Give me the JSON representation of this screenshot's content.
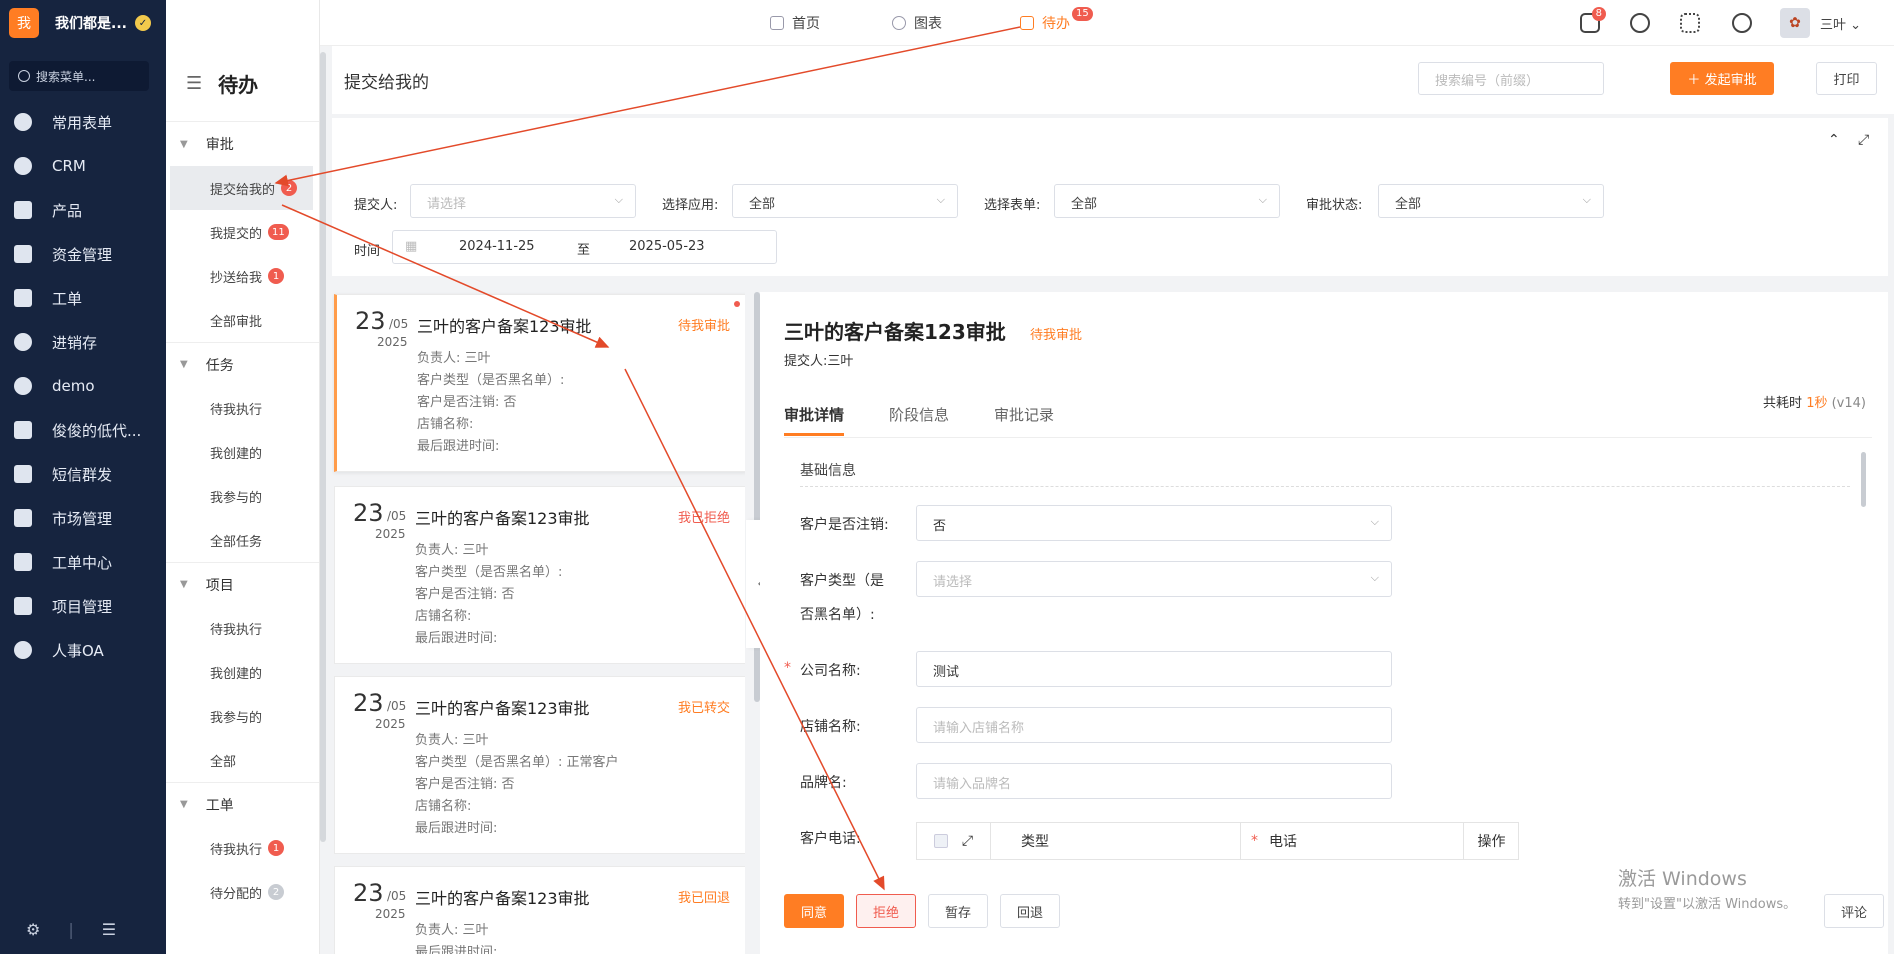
{
  "brand": {
    "logo_text": "我",
    "name": "我们都是..."
  },
  "sidebar": {
    "search_placeholder": "搜索菜单...",
    "items": [
      {
        "label": "常用表单",
        "icon": "star-icon"
      },
      {
        "label": "CRM",
        "icon": "pie-icon"
      },
      {
        "label": "产品",
        "icon": "boxes-icon"
      },
      {
        "label": "资金管理",
        "icon": "wallet-icon"
      },
      {
        "label": "工单",
        "icon": "clipboard-icon"
      },
      {
        "label": "进销存",
        "icon": "cycle-icon"
      },
      {
        "label": "demo",
        "icon": "gear-icon"
      },
      {
        "label": "俊俊的低代...",
        "icon": "doc-icon"
      },
      {
        "label": "短信群发",
        "icon": "mail-icon"
      },
      {
        "label": "市场管理",
        "icon": "clipboard-icon"
      },
      {
        "label": "工单中心",
        "icon": "clipboard-icon"
      },
      {
        "label": "项目管理",
        "icon": "layers-icon"
      },
      {
        "label": "人事OA",
        "icon": "globe-icon"
      }
    ]
  },
  "submenu": {
    "title": "待办",
    "groups": [
      {
        "label": "审批",
        "items": [
          {
            "label": "提交给我的",
            "badge": "2"
          },
          {
            "label": "我提交的",
            "badge": "11"
          },
          {
            "label": "抄送给我",
            "badge": "1"
          },
          {
            "label": "全部审批",
            "badge": ""
          }
        ]
      },
      {
        "label": "任务",
        "items": [
          {
            "label": "待我执行"
          },
          {
            "label": "我创建的"
          },
          {
            "label": "我参与的"
          },
          {
            "label": "全部任务"
          }
        ]
      },
      {
        "label": "项目",
        "items": [
          {
            "label": "待我执行"
          },
          {
            "label": "我创建的"
          },
          {
            "label": "我参与的"
          },
          {
            "label": "全部"
          }
        ]
      },
      {
        "label": "工单",
        "items": [
          {
            "label": "待我执行",
            "badge": "1"
          },
          {
            "label": "待分配的",
            "badge": "2"
          }
        ]
      }
    ]
  },
  "topbar": {
    "tabs": [
      {
        "label": "首页"
      },
      {
        "label": "图表"
      },
      {
        "label": "待办",
        "badge": "15"
      }
    ],
    "message_badge": "8",
    "user": "三叶"
  },
  "page": {
    "title": "提交给我的",
    "search_placeholder": "搜索编号（前缀）",
    "start_button": "发起审批",
    "print_button": "打印"
  },
  "filters": {
    "submitter_label": "提交人:",
    "submitter_placeholder": "请选择",
    "app_label": "选择应用:",
    "app_value": "全部",
    "form_label": "选择表单:",
    "form_value": "全部",
    "status_label": "审批状态:",
    "status_value": "全部",
    "time_label": "时间",
    "date_from": "2024-11-25",
    "date_sep": "至",
    "date_to": "2025-05-23"
  },
  "cards": [
    {
      "day": "23",
      "mon": "/05",
      "year": "2025",
      "title": "三叶的客户备案123审批",
      "status": "待我审批",
      "status_color": "#ff7d23",
      "lines": [
        "负责人: 三叶",
        "客户类型（是否黑名单）:",
        "客户是否注销: 否",
        "店铺名称:",
        "最后跟进时间:"
      ]
    },
    {
      "day": "23",
      "mon": "/05",
      "year": "2025",
      "title": "三叶的客户备案123审批",
      "status": "我已拒绝",
      "status_color": "#f05c4f",
      "lines": [
        "负责人: 三叶",
        "客户类型（是否黑名单）:",
        "客户是否注销: 否",
        "店铺名称:",
        "最后跟进时间:"
      ]
    },
    {
      "day": "23",
      "mon": "/05",
      "year": "2025",
      "title": "三叶的客户备案123审批",
      "status": "我已转交",
      "status_color": "#ff7d23",
      "lines": [
        "负责人: 三叶",
        "客户类型（是否黑名单）: 正常客户",
        "客户是否注销: 否",
        "店铺名称:",
        "最后跟进时间:"
      ]
    },
    {
      "day": "23",
      "mon": "/05",
      "year": "2025",
      "title": "三叶的客户备案123审批",
      "status": "我已回退",
      "status_color": "#ff7d23",
      "lines": [
        "负责人: 三叶",
        "最后跟进时间:"
      ]
    }
  ],
  "detail": {
    "title": "三叶的客户备案123审批",
    "status": "待我审批",
    "submitter": "提交人:三叶",
    "time_label": "共耗时",
    "time_value": "1秒",
    "version": "(v14)",
    "tabs": [
      "审批详情",
      "阶段信息",
      "审批记录"
    ],
    "section": "基础信息",
    "fields": {
      "cancelled_label": "客户是否注销:",
      "cancelled_value": "否",
      "type_label_1": "客户类型（是",
      "type_label_2": "否黑名单）:",
      "type_placeholder": "请选择",
      "company_label": "公司名称:",
      "company_value": "测试",
      "shop_label": "店铺名称:",
      "shop_placeholder": "请输入店铺名称",
      "brand_label": "品牌名:",
      "brand_placeholder": "请输入品牌名",
      "phone_label": "客户电话:"
    },
    "phone_table": {
      "col_type": "类型",
      "col_phone": "电话",
      "col_op": "操作"
    },
    "actions": {
      "agree": "同意",
      "reject": "拒绝",
      "save": "暂存",
      "back": "回退",
      "comment": "评论"
    }
  },
  "watermark": {
    "line1": "激活 Windows",
    "line2": "转到\"设置\"以激活 Windows。"
  },
  "colors": {
    "accent": "#ff7d23",
    "sidebar": "#16243f",
    "danger": "#f05c4f",
    "annotation": "#e34a2a"
  }
}
